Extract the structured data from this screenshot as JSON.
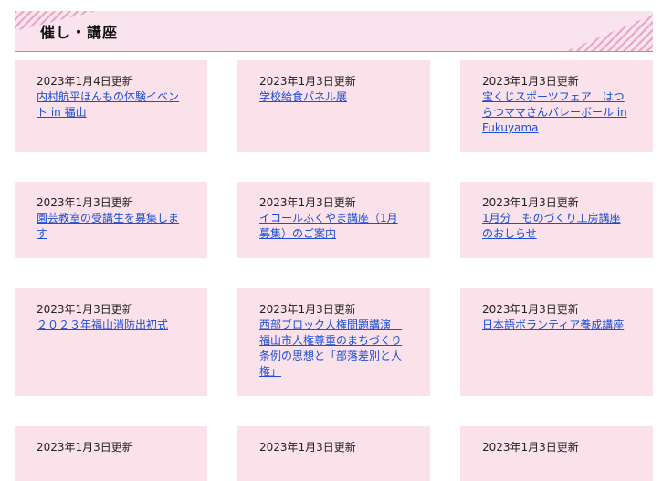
{
  "section": {
    "title": "催し・講座"
  },
  "items": [
    {
      "date": "2023年1月4日更新",
      "title": "内村航平ほんもの体験イベント in 福山"
    },
    {
      "date": "2023年1月3日更新",
      "title": "学校給食パネル展"
    },
    {
      "date": "2023年1月3日更新",
      "title": "宝くじスポーツフェア　はつらつママさんバレーボール in Fukuyama"
    },
    {
      "date": "2023年1月3日更新",
      "title": "園芸教室の受講生を募集します"
    },
    {
      "date": "2023年1月3日更新",
      "title": "イコールふくやま講座（1月募集）のご案内"
    },
    {
      "date": "2023年1月3日更新",
      "title": "1月分　ものづくり工房講座のおしらせ"
    },
    {
      "date": "2023年1月3日更新",
      "title": "２０２３年福山消防出初式"
    },
    {
      "date": "2023年1月3日更新",
      "title": "西部ブロック人権問題講演　福山市人権尊重のまちづくり条例の思想と「部落差別と人権」"
    },
    {
      "date": "2023年1月3日更新",
      "title": "日本語ボランティア養成講座"
    },
    {
      "date": "2023年1月3日更新",
      "title": ""
    },
    {
      "date": "2023年1月3日更新",
      "title": ""
    },
    {
      "date": "2023年1月3日更新",
      "title": ""
    }
  ],
  "colors": {
    "card_bg": "#fbe1ea",
    "header_bg": "#f9e3ec",
    "link": "#1a4fd6",
    "accent": "#d47a9a"
  }
}
